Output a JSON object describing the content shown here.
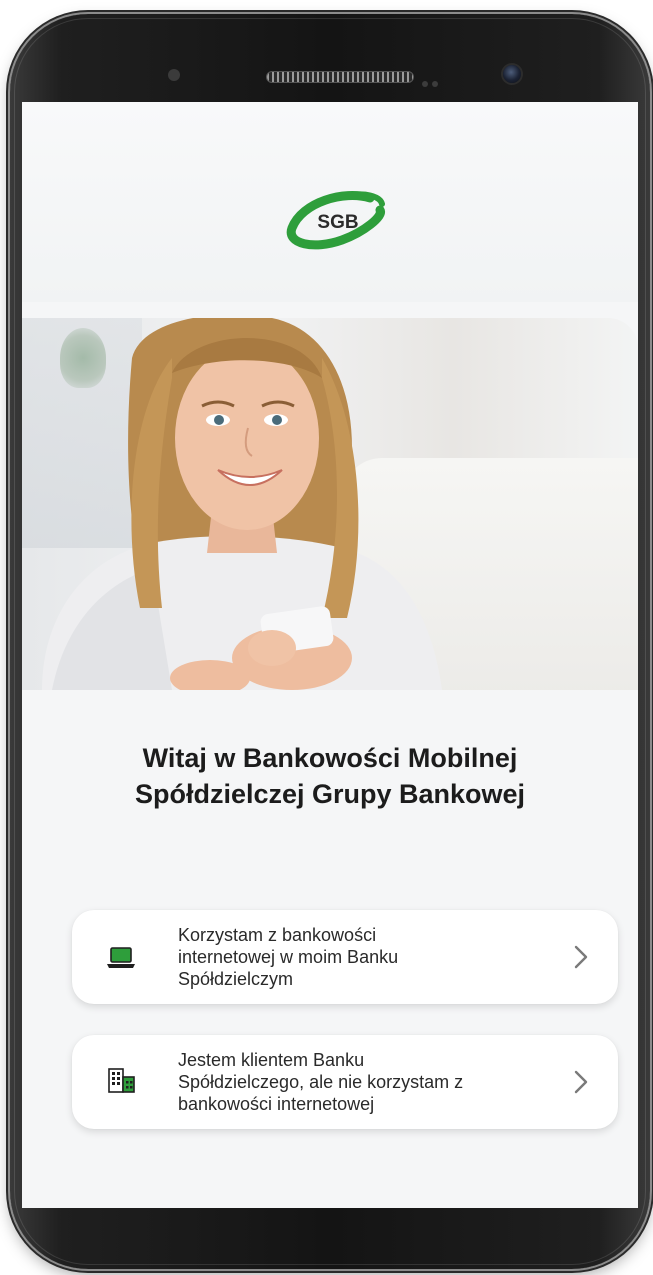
{
  "app": {
    "logo_text": "SGB",
    "brand_color": "#2e9e3b"
  },
  "welcome": {
    "line1": "Witaj w Bankowości Mobilnej",
    "line2": "Spółdzielczej Grupy Bankowej"
  },
  "options": [
    {
      "icon": "laptop-icon",
      "lines": [
        "Korzystam z bankowości",
        "internetowej w moim Banku",
        "Spółdzielczym"
      ]
    },
    {
      "icon": "building-icon",
      "lines": [
        "Jestem klientem Banku",
        "Spółdzielczego, ale nie korzystam z",
        "bankowości internetowej"
      ]
    }
  ],
  "colors": {
    "accent_green": "#2e9e3b",
    "text_dark": "#1c1c1c",
    "chevron": "#7a7a7a"
  }
}
